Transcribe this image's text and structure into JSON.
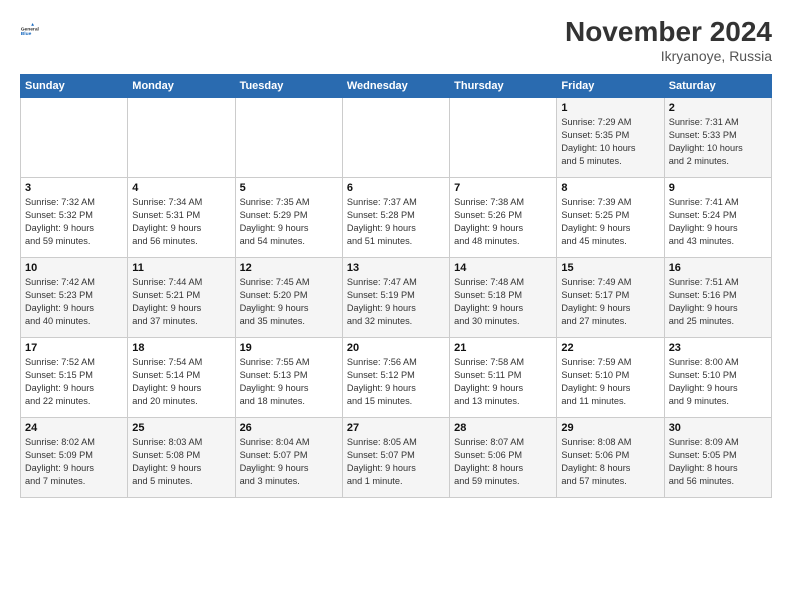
{
  "header": {
    "logo": {
      "line1": "General",
      "line2": "Blue"
    },
    "title": "November 2024",
    "location": "Ikryanoye, Russia"
  },
  "weekdays": [
    "Sunday",
    "Monday",
    "Tuesday",
    "Wednesday",
    "Thursday",
    "Friday",
    "Saturday"
  ],
  "weeks": [
    [
      {
        "day": "",
        "info": ""
      },
      {
        "day": "",
        "info": ""
      },
      {
        "day": "",
        "info": ""
      },
      {
        "day": "",
        "info": ""
      },
      {
        "day": "",
        "info": ""
      },
      {
        "day": "1",
        "info": "Sunrise: 7:29 AM\nSunset: 5:35 PM\nDaylight: 10 hours\nand 5 minutes."
      },
      {
        "day": "2",
        "info": "Sunrise: 7:31 AM\nSunset: 5:33 PM\nDaylight: 10 hours\nand 2 minutes."
      }
    ],
    [
      {
        "day": "3",
        "info": "Sunrise: 7:32 AM\nSunset: 5:32 PM\nDaylight: 9 hours\nand 59 minutes."
      },
      {
        "day": "4",
        "info": "Sunrise: 7:34 AM\nSunset: 5:31 PM\nDaylight: 9 hours\nand 56 minutes."
      },
      {
        "day": "5",
        "info": "Sunrise: 7:35 AM\nSunset: 5:29 PM\nDaylight: 9 hours\nand 54 minutes."
      },
      {
        "day": "6",
        "info": "Sunrise: 7:37 AM\nSunset: 5:28 PM\nDaylight: 9 hours\nand 51 minutes."
      },
      {
        "day": "7",
        "info": "Sunrise: 7:38 AM\nSunset: 5:26 PM\nDaylight: 9 hours\nand 48 minutes."
      },
      {
        "day": "8",
        "info": "Sunrise: 7:39 AM\nSunset: 5:25 PM\nDaylight: 9 hours\nand 45 minutes."
      },
      {
        "day": "9",
        "info": "Sunrise: 7:41 AM\nSunset: 5:24 PM\nDaylight: 9 hours\nand 43 minutes."
      }
    ],
    [
      {
        "day": "10",
        "info": "Sunrise: 7:42 AM\nSunset: 5:23 PM\nDaylight: 9 hours\nand 40 minutes."
      },
      {
        "day": "11",
        "info": "Sunrise: 7:44 AM\nSunset: 5:21 PM\nDaylight: 9 hours\nand 37 minutes."
      },
      {
        "day": "12",
        "info": "Sunrise: 7:45 AM\nSunset: 5:20 PM\nDaylight: 9 hours\nand 35 minutes."
      },
      {
        "day": "13",
        "info": "Sunrise: 7:47 AM\nSunset: 5:19 PM\nDaylight: 9 hours\nand 32 minutes."
      },
      {
        "day": "14",
        "info": "Sunrise: 7:48 AM\nSunset: 5:18 PM\nDaylight: 9 hours\nand 30 minutes."
      },
      {
        "day": "15",
        "info": "Sunrise: 7:49 AM\nSunset: 5:17 PM\nDaylight: 9 hours\nand 27 minutes."
      },
      {
        "day": "16",
        "info": "Sunrise: 7:51 AM\nSunset: 5:16 PM\nDaylight: 9 hours\nand 25 minutes."
      }
    ],
    [
      {
        "day": "17",
        "info": "Sunrise: 7:52 AM\nSunset: 5:15 PM\nDaylight: 9 hours\nand 22 minutes."
      },
      {
        "day": "18",
        "info": "Sunrise: 7:54 AM\nSunset: 5:14 PM\nDaylight: 9 hours\nand 20 minutes."
      },
      {
        "day": "19",
        "info": "Sunrise: 7:55 AM\nSunset: 5:13 PM\nDaylight: 9 hours\nand 18 minutes."
      },
      {
        "day": "20",
        "info": "Sunrise: 7:56 AM\nSunset: 5:12 PM\nDaylight: 9 hours\nand 15 minutes."
      },
      {
        "day": "21",
        "info": "Sunrise: 7:58 AM\nSunset: 5:11 PM\nDaylight: 9 hours\nand 13 minutes."
      },
      {
        "day": "22",
        "info": "Sunrise: 7:59 AM\nSunset: 5:10 PM\nDaylight: 9 hours\nand 11 minutes."
      },
      {
        "day": "23",
        "info": "Sunrise: 8:00 AM\nSunset: 5:10 PM\nDaylight: 9 hours\nand 9 minutes."
      }
    ],
    [
      {
        "day": "24",
        "info": "Sunrise: 8:02 AM\nSunset: 5:09 PM\nDaylight: 9 hours\nand 7 minutes."
      },
      {
        "day": "25",
        "info": "Sunrise: 8:03 AM\nSunset: 5:08 PM\nDaylight: 9 hours\nand 5 minutes."
      },
      {
        "day": "26",
        "info": "Sunrise: 8:04 AM\nSunset: 5:07 PM\nDaylight: 9 hours\nand 3 minutes."
      },
      {
        "day": "27",
        "info": "Sunrise: 8:05 AM\nSunset: 5:07 PM\nDaylight: 9 hours\nand 1 minute."
      },
      {
        "day": "28",
        "info": "Sunrise: 8:07 AM\nSunset: 5:06 PM\nDaylight: 8 hours\nand 59 minutes."
      },
      {
        "day": "29",
        "info": "Sunrise: 8:08 AM\nSunset: 5:06 PM\nDaylight: 8 hours\nand 57 minutes."
      },
      {
        "day": "30",
        "info": "Sunrise: 8:09 AM\nSunset: 5:05 PM\nDaylight: 8 hours\nand 56 minutes."
      }
    ]
  ]
}
